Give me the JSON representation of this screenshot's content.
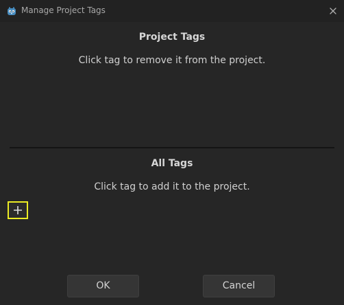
{
  "window": {
    "title": "Manage Project Tags",
    "app_icon": "godot-icon",
    "close_icon": "close-icon"
  },
  "project_tags": {
    "heading": "Project Tags",
    "hint": "Click tag to remove it from the project.",
    "tags": []
  },
  "all_tags": {
    "heading": "All Tags",
    "hint": "Click tag to add it to the project.",
    "tags": [],
    "add_icon": "plus-icon"
  },
  "buttons": {
    "ok_label": "OK",
    "cancel_label": "Cancel"
  },
  "colors": {
    "focus_outline": "#ecec24",
    "app_icon_blue": "#478cbf"
  }
}
